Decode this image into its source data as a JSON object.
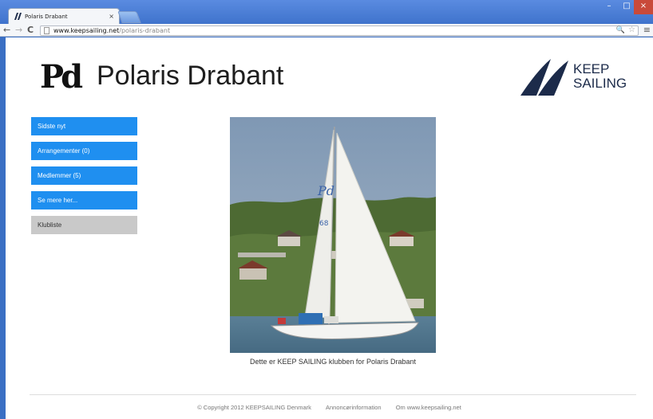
{
  "browser": {
    "tab_title": "Polaris Drabant",
    "tab_close": "×",
    "url_host": "www.keepsailing.net",
    "url_path": "/polaris-drabant",
    "window_min": "–",
    "window_max": "□",
    "window_close": "×",
    "back": "←",
    "forward": "→",
    "reload": "C",
    "zoom_icon": "🔍",
    "star_icon": "☆",
    "menu_icon": "≡"
  },
  "header": {
    "logo_text": "Pd",
    "title": "Polaris Drabant",
    "brand_line1": "KEEP",
    "brand_line2": "SAILING"
  },
  "sidebar": {
    "items": [
      {
        "label": "Sidste nyt"
      },
      {
        "label": "Arrangementer (0)"
      },
      {
        "label": "Medlemmer (5)"
      },
      {
        "label": "Se mere her..."
      },
      {
        "label": "Klubliste"
      }
    ]
  },
  "main": {
    "caption": "Dette er KEEP SAILING klubben for Polaris Drabant",
    "sail_text_1": "Pd",
    "sail_text_2": "68"
  },
  "footer": {
    "copyright": "© Copyright 2012 KEEPSAILING Denmark",
    "ads": "Annoncørinformation",
    "about": "Om www.keepsailing.net"
  },
  "colors": {
    "nav_blue": "#1f8ff0",
    "nav_gray": "#c9c9c9",
    "brand_navy": "#1c2b4a"
  }
}
